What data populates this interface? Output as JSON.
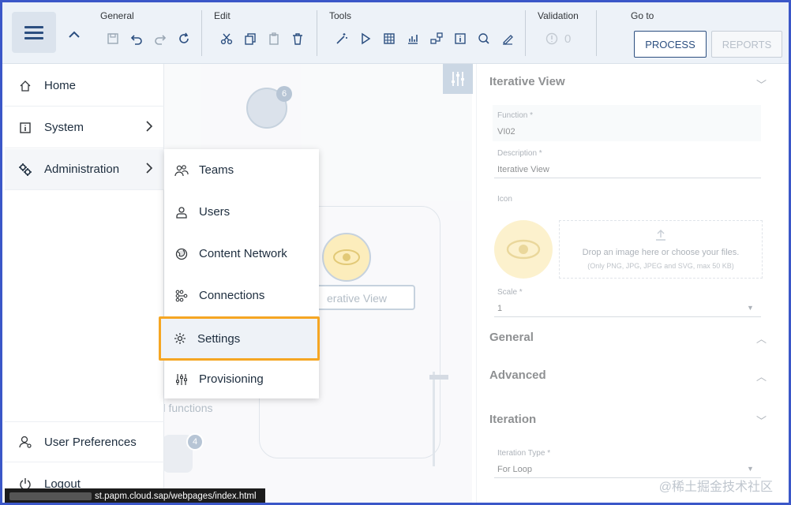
{
  "toolbar": {
    "groups": {
      "general": "General",
      "edit": "Edit",
      "tools": "Tools",
      "validation": "Validation",
      "goto": "Go to"
    },
    "validation_count": "0",
    "process_label": "PROCESS",
    "reports_label": "REPORTS"
  },
  "nav": {
    "items": [
      {
        "label": "Home",
        "icon": "home-icon"
      },
      {
        "label": "System",
        "icon": "info-icon"
      },
      {
        "label": "Administration",
        "icon": "gears-icon"
      }
    ],
    "bottom": [
      {
        "label": "User Preferences",
        "icon": "user-settings-icon"
      },
      {
        "label": "Logout",
        "icon": "power-icon"
      }
    ]
  },
  "submenu": {
    "items": [
      {
        "label": "Teams",
        "icon": "group-icon"
      },
      {
        "label": "Users",
        "icon": "person-icon"
      },
      {
        "label": "Content Network",
        "icon": "globe-icon"
      },
      {
        "label": "Connections",
        "icon": "connections-icon"
      },
      {
        "label": "Settings",
        "icon": "gear-icon"
      },
      {
        "label": "Provisioning",
        "icon": "sliders-icon"
      }
    ]
  },
  "canvas": {
    "node_badge_top": "6",
    "node_badge_bottom": "4",
    "iterative_view_node": "erative View",
    "ghost_functions": "ed functions"
  },
  "panel": {
    "section_title": "Iterative View",
    "function_label": "Function *",
    "function_value": "VI02",
    "description_label": "Description *",
    "description_value": "Iterative View",
    "icon_label": "Icon",
    "upload_text_1": "Drop an image here or choose your files.",
    "upload_text_2": "(Only PNG, JPG, JPEG and SVG, max 50 KB)",
    "scale_label": "Scale *",
    "scale_value": "1",
    "general_title": "General",
    "advanced_title": "Advanced",
    "iteration_title": "Iteration",
    "iteration_type_label": "Iteration Type *",
    "iteration_type_value": "For Loop"
  },
  "statusbar": {
    "url": "st.papm.cloud.sap/webpages/index.html"
  },
  "watermark": "@稀土掘金技术社区",
  "colors": {
    "accent": "#2c4f80",
    "highlight": "#f5a623",
    "frame": "#3b57c8"
  }
}
